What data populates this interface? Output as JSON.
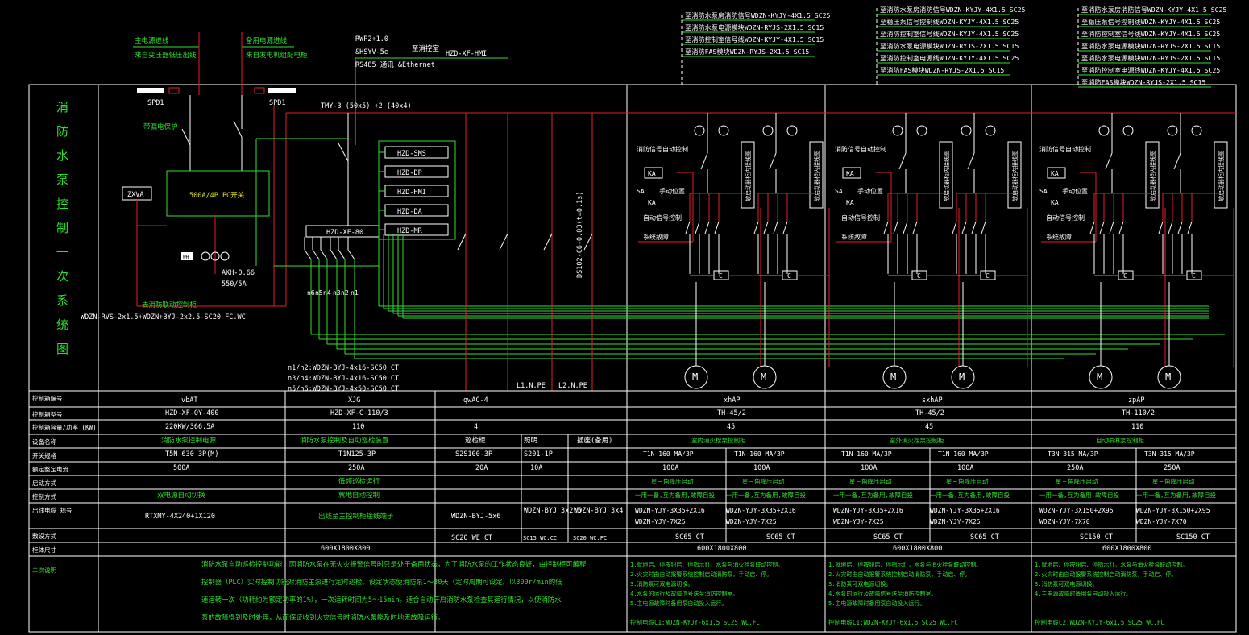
{
  "title_chars": [
    "消",
    "防",
    "水",
    "泵",
    "控",
    "制",
    "一",
    "次",
    "系",
    "统",
    "图"
  ],
  "top": {
    "source_main": [
      "主电源进线",
      "来自变压器低压出线"
    ],
    "source_backup": [
      "备用电源进线",
      "来自发电机组配电柜"
    ],
    "spd_left": "SPD1",
    "spd_right": "SPD1",
    "comm_lines": [
      "RWP2+1.0",
      "&HSYV-5e",
      "RS485    通讯   &Ethernet"
    ],
    "comm_dest": "至消控室",
    "hmi_ref": "HZD-XF-HMI",
    "busbar": "TMY-3 (50x5) +2 (40x4)",
    "breaker_note": "带漏电保护",
    "pc_box": "500A/4P PC开关",
    "zxva": "ZXVA",
    "wh": "WH",
    "akh": [
      "AKH-0.66",
      "550/5A"
    ],
    "fire_link": "去消防联动控制柜",
    "cable_left": "WDZN-RVS-2x1.5+WDZN+BYJ-2x2.5-SC20 FC.WC",
    "dsd": "DS102-C6-0.03(t=0.1s)",
    "n_labels": [
      "n6",
      "n5",
      "n4",
      "n3",
      "n2",
      "n1"
    ],
    "cables_mid": [
      "n1/n2:WDZN-BYJ-4x16-SC50 CT",
      "n3/n4:WDZN-BYJ-4x16-SC50 CT",
      "n5/n6:WDZN-BYJ-4x50-SC50 CT"
    ],
    "ln1": "L1.N.PE",
    "ln2": "L2.N.PE"
  },
  "modules": [
    "HZD-SMS",
    "HZD-DP",
    "HZD-HMI",
    "HZD-DA",
    "HZD-MR"
  ],
  "controller": "HZD-XF-80",
  "legends": [
    [
      "至消防水泵房消防信号WDZN-KYJY-4X1.5  SC25",
      "至消防水泵电源模块WDZN-RYJS-2X1.5  SC15",
      "至消防控制室信号线WDZN-KYJY-4X1.5  SC15",
      "至消防FAS模块WDZN-RYJS-2X1.5  SC15"
    ],
    [
      "至消防水泵房消防信号WDZN-KYJY-4X1.5  SC25",
      "至稳压泵信号控制线WDZN-KYJY-4X1.5  SC25",
      "至消防控制室信号线WDZN-KYJY-4X1.5  SC25",
      "至消防水泵电源模块WDZN-RYJS-2X1.5  SC15",
      "至消防控制室电源线WDZN-KYJY-4X1.5  SC25",
      "至消防FAS模块WDZN-RYJS-2X1.5  SC15"
    ],
    [
      "至消防水泵房消防信号WDZN-KYJY-4X1.5  SC25",
      "至稳压泵信号控制线WDZN-KYJY-4X1.5  SC25",
      "至消防控制室信号线WDZN-KYJY-4X1.5  SC25",
      "至消防水泵电源模块WDZN-RYJS-2X1.5  SC15",
      "至消防水泵电源模块WDZN-RYJS-2X1.5  SC15",
      "至消防控制室电源线WDZN-KYJY-4X1.5  SC25",
      "至消防FAS模块WDZN-RYJS-2X1.5  SC15"
    ]
  ],
  "pump_labels": {
    "ka": "KA",
    "sa": "SA",
    "manual": "手动位置",
    "auto": "自动信号控制",
    "fire_sig": "消防信号自动控制",
    "sys_fault": "系统故障",
    "contactor": "C",
    "motor": "M",
    "tall_box": "软启动器柜内接线图"
  },
  "table": {
    "row_labels": [
      "控制箱编号",
      "控制箱型号",
      "控制箱容量/功率  (KW)",
      "设备名称",
      "开关规格",
      "额定整定电流",
      "启动方式",
      "控制方式",
      "出线电缆 规号",
      "敷设方式",
      "柜体尺寸",
      "二次说明"
    ],
    "cols": {
      "vbAT": {
        "id": "vbAT",
        "model": "HZD-XF-QY-400",
        "cap": "220KW/366.5A",
        "dev": "消防水泵控制电源",
        "sw": "T5N 630 3P(M)",
        "cur": "500A",
        "start": "",
        "ctrl": "双电源自动切换",
        "cable": "RTXMY-4X240+1X120",
        "lay": ""
      },
      "xjg": {
        "id": "XJG",
        "model": "HZD-XF-C-110/3",
        "cap": "110",
        "dev": "消防水泵控制及自动巡检装置",
        "sw": "T1N125-3P",
        "cur": "250A",
        "start": "低频巡检运行",
        "ctrl": "就地自动控制",
        "cable": "出线至主控制柜接线端子",
        "lay": ""
      },
      "qwac": {
        "id": "qwAC-4",
        "cap": "4",
        "sub": [
          [
            "巡检柜",
            "S2S100-3P",
            "20A",
            "WDZN-BYJ-5x6",
            "SC20 WE CT"
          ],
          [
            "照明",
            "S201-1P",
            "10A",
            "WDZN-BYJ 3x2.5",
            "SC15 WC.CC"
          ],
          [
            "插座(备用)",
            "",
            "",
            "WDZN-BYJ 3x4",
            "SC20 WC.FC"
          ]
        ]
      },
      "xhap": {
        "id": "xhAP",
        "model": "TH-45/2",
        "cap": "45",
        "dev": "室内消火栓泵控制柜",
        "sw": [
          "T1N 160 MA/3P",
          "T1N 160 MA/3P"
        ],
        "cur": [
          "100A",
          "100A"
        ],
        "start": [
          "星三角降压启动",
          "星三角降压启动"
        ],
        "ctrl": [
          "一用一备,互为备用,故障自投",
          "一用一备,互为备用,故障自投"
        ],
        "cable": [
          [
            "WDZN-YJY-3X35+2X16",
            "WDZN-YJY-7X25"
          ],
          [
            "WDZN-YJY-3X35+2X16",
            "WDZN-YJY-7X25"
          ]
        ],
        "lay": [
          "SC65 CT",
          "SC65 CT"
        ]
      },
      "sxhap": {
        "id": "sxhAP",
        "model": "TH-45/2",
        "cap": "45",
        "dev": "室外消火栓泵控制柜",
        "sw": [
          "T1N 160 MA/3P",
          "T1N 160 MA/3P"
        ],
        "cur": [
          "100A",
          "100A"
        ],
        "start": [
          "星三角降压启动",
          "星三角降压启动"
        ],
        "ctrl": [
          "一用一备,互为备用,故障自投",
          "一用一备,互为备用,故障自投"
        ],
        "cable": [
          [
            "WDZN-YJY-3X35+2X16",
            "WDZN-YJY-7X25"
          ],
          [
            "WDZN-YJY-3X35+2X16",
            "WDZN-YJY-7X25"
          ]
        ],
        "lay": [
          "SC65 CT",
          "SC65 CT"
        ]
      },
      "zpap": {
        "id": "zpAP",
        "model": "TH-110/2",
        "cap": "110",
        "dev": "自动喷淋泵控制柜",
        "sw": [
          "T3N 315 MA/3P",
          "T3N 315 MA/3P"
        ],
        "cur": [
          "250A",
          "250A"
        ],
        "start": [
          "星三角降压启动",
          "星三角降压启动"
        ],
        "ctrl": [
          "一用一备,互为备用,故障自投",
          "一用一备,互为备用,故障自投"
        ],
        "cable": [
          [
            "WDZN-YJY-3X150+2X95",
            "WDZN-YJY-7X70"
          ],
          [
            "WDZN-YJY-3X150+2X95",
            "WDZN-YJY-7X70"
          ]
        ],
        "lay": [
          "SC150 CT",
          "SC150 CT"
        ]
      }
    },
    "size_1": "600X1800X800",
    "size_2": "600X1800X800",
    "size_3": "600X1800X800",
    "size_4": "600X1800X800",
    "note_main": [
      "消防水泵自动巡检控制功能：因消防水泵在无火灾报警信号时只是处于备用状态，为了消防水泵的工作状态良好，由控制柜可编程",
      "控制器（PLC）实时控制功能对消防主泵进行定时巡检。设定状态使消防泵1～30天（定时周期可设定）以300r/min的低",
      "速运转一次（功耗约为额定功率的1%），一次运转时间为5～15min。适合自动开启消防水泵检查其运行情况，以使消防水",
      "泵的故障得到及时处理，从而保证收到火灾信号时消防水泵能及时地无故障运行。"
    ],
    "note_pump": [
      "1.就地启、停按钮启、停指示灯，水泵与消火栓泵联动控制。",
      "2.火灾时由自动报警系统控制启动消防泵，手动启、停。",
      "3.消防泵可双电源切换。",
      "4.水泵的运行及故障信号送至消防控制室。",
      "5.主电源故障时备用泵自动投入运行。"
    ],
    "note_pump3": [
      "1.就地启、停按钮启、停指示灯，水泵与消火栓泵联动控制。",
      "2.火灾时由自动报警系统控制启动消防泵，手动启、停。",
      "3.消防泵可双电源切换。",
      "4.主电源故障时备用泵自动投入运行。"
    ],
    "pump_cable_1": "控制电缆C1:WDZN-KYJY-6x1.5  SC25  WC.FC",
    "pump_cable_2": "控制电缆C1:WDZN-KYJY-6x1.5  SC25  WC.FC",
    "pump_cable_3": "控制电缆C2:WDZN-KYJY-6x1.5  SC25  WC.FC"
  },
  "colors": {
    "red": "#e8202a",
    "green": "#2fe02f",
    "white": "#ffffff",
    "yellow": "#e6e61e",
    "cyan": "#1fd8d8",
    "bg": "#000000"
  }
}
